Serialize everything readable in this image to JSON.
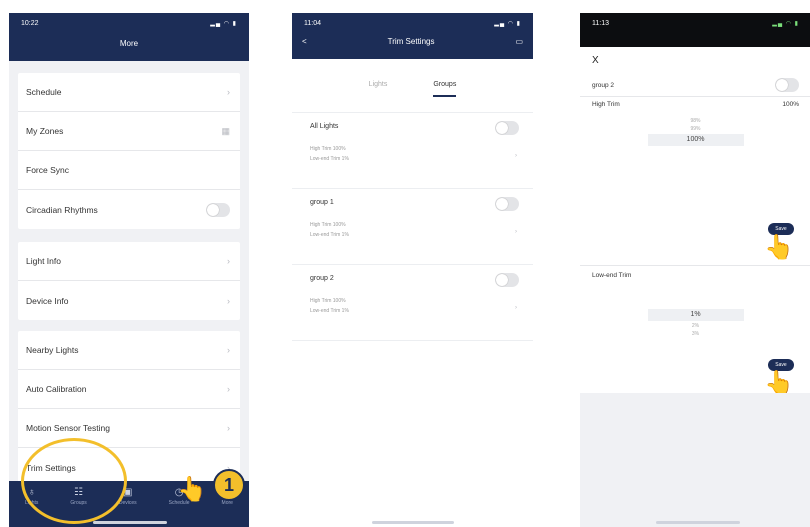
{
  "phone1": {
    "time": "10:22",
    "title": "More",
    "group1": [
      "Schedule",
      "My Zones",
      "Force Sync",
      "Circadian Rhythms"
    ],
    "group2": [
      "Light Info",
      "Device Info"
    ],
    "group3": [
      "Nearby Lights",
      "Auto Calibration",
      "Motion Sensor Testing",
      "Trim Settings"
    ],
    "tabs": [
      "Lights",
      "Groups",
      "Devices",
      "Schedule",
      "More"
    ],
    "step_number": "1"
  },
  "phone2": {
    "time": "11:04",
    "title": "Trim Settings",
    "back": "<",
    "tabs": [
      "Lights",
      "Groups"
    ],
    "groups": [
      {
        "name": "All Lights",
        "high": "High Trim 100%",
        "low": "Low-end Trim 1%"
      },
      {
        "name": "group 1",
        "high": "High Trim 100%",
        "low": "Low-end Trim 1%"
      },
      {
        "name": "group 2",
        "high": "High Trim 100%",
        "low": "Low-end Trim 1%"
      }
    ]
  },
  "phone3": {
    "time": "11:13",
    "close": "X",
    "group_name": "group 2",
    "high_label": "High Trim",
    "high_value": "100%",
    "high_picker": [
      "98%",
      "99%",
      "100%"
    ],
    "low_label": "Low-end Trim",
    "low_picker": [
      "1%",
      "2%",
      "3%"
    ],
    "save_label": "Save"
  }
}
